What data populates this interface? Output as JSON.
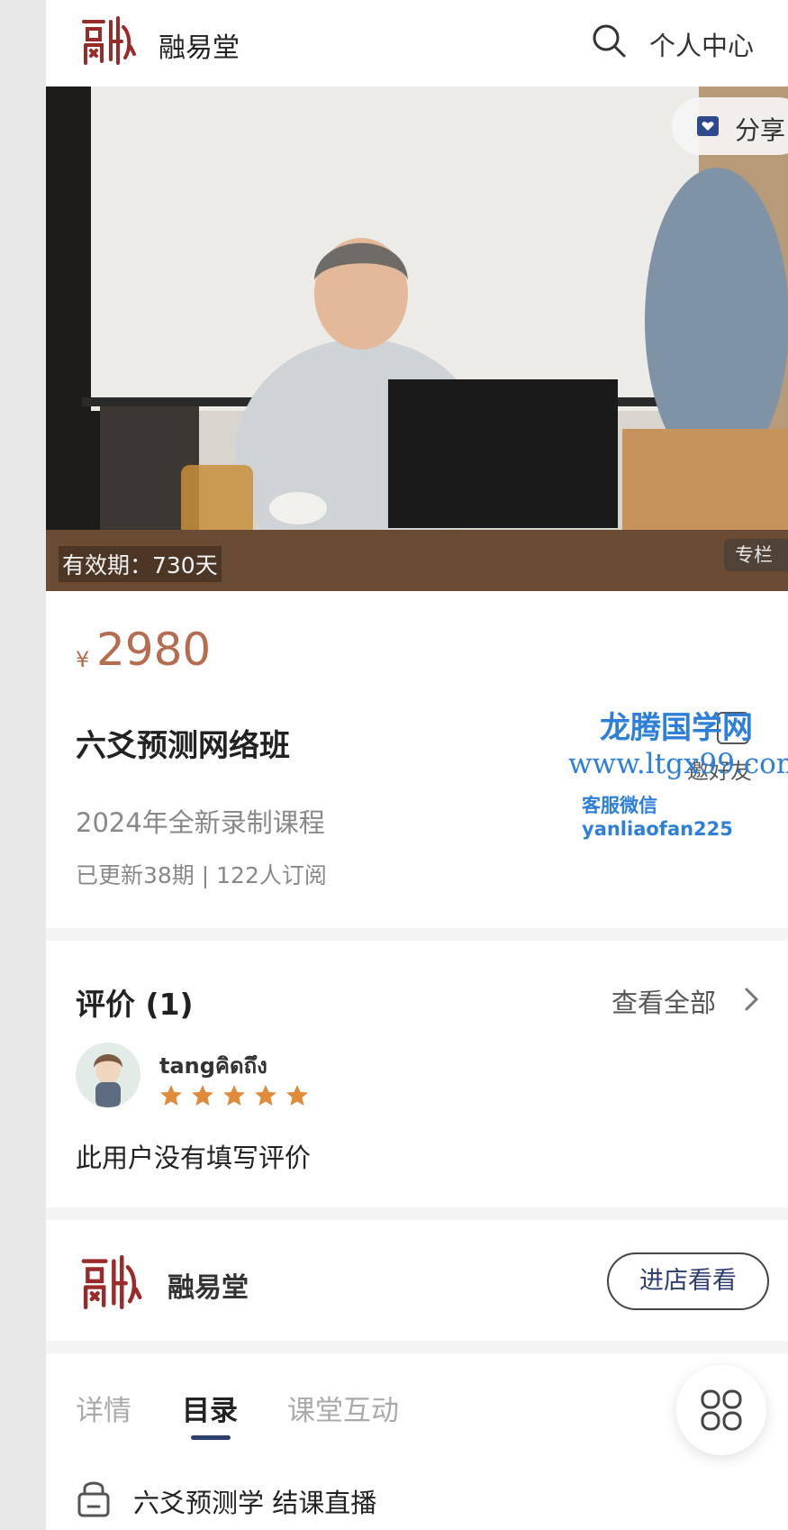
{
  "header": {
    "brand": "融易堂",
    "search_icon": "search-icon",
    "user_center": "个人中心"
  },
  "hero": {
    "share_label": "分享",
    "validity": "有效期：730天",
    "column_tag": "专栏"
  },
  "product": {
    "currency": "¥",
    "price": "2980",
    "title": "六爻预测网络班",
    "subtitle": "2024年全新录制课程",
    "meta": "已更新38期 | 122人订阅",
    "invite_label": "邀好友"
  },
  "watermark": {
    "line1": "龙腾国学网",
    "line2": "www.ltgx99.com",
    "line3": "客服微信 yanliaofan225"
  },
  "reviews": {
    "title": "评价 (1)",
    "view_all": "查看全部",
    "items": [
      {
        "user": "tangคิดถึง",
        "rating": 5,
        "text": "此用户没有填写评价"
      }
    ]
  },
  "shop": {
    "name": "融易堂",
    "enter_label": "进店看看"
  },
  "tabs": {
    "detail": "详情",
    "catalog": "目录",
    "interaction": "课堂互动",
    "active": "目录"
  },
  "catalog": {
    "first_lesson": "六爻预测学 结课直播"
  },
  "colors": {
    "price": "#b66c4e",
    "accent": "#2c3e70",
    "star": "#e08a3c",
    "watermark": "#2e7fd8",
    "seal": "#9a2b2b"
  }
}
